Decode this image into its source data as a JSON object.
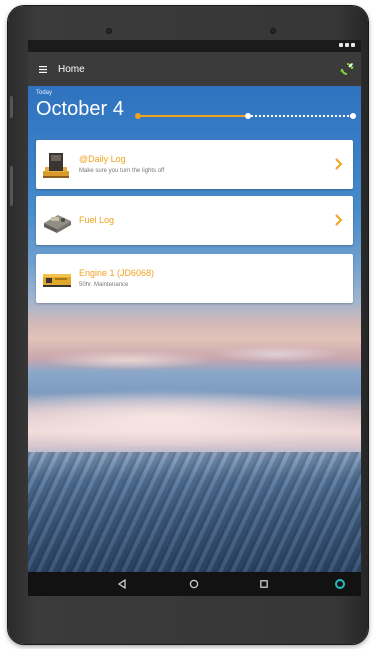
{
  "appbar": {
    "title": "Home",
    "menu_icon": "hamburger-menu-icon",
    "sync_icon": "sync-icon"
  },
  "header": {
    "today_label": "Today",
    "date": "October 4"
  },
  "cards": [
    {
      "title": "@Daily Log",
      "subtitle": "Make sure you turn the lights off",
      "icon": "daily-log-generator-thumbnail"
    },
    {
      "title": "Fuel Log",
      "subtitle": "",
      "icon": "fuel-log-engine-thumbnail"
    },
    {
      "title": "Engine 1 (JD6068)",
      "subtitle": "50hr. Maintenance",
      "icon": "engine-generator-thumbnail"
    }
  ],
  "navbar": {
    "back_icon": "back-triangle-icon",
    "home_icon": "home-circle-icon",
    "recents_icon": "recents-square-icon",
    "assistant_icon": "assistant-ring-icon"
  },
  "colors": {
    "accent": "#f0a21e",
    "appbar": "#3b3b3b",
    "sync": "#7bd53a",
    "assistant": "#2bb6c6"
  }
}
